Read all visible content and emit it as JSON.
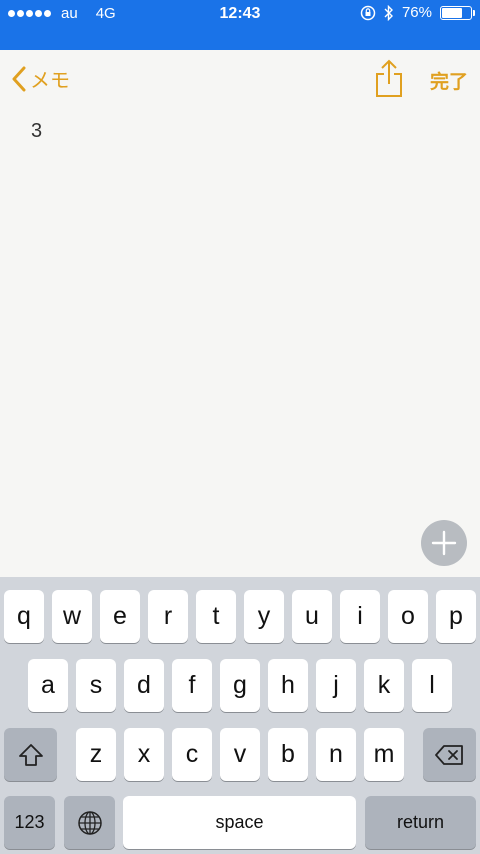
{
  "status_bar": {
    "carrier": "au",
    "network": "4G",
    "time": "12:43",
    "battery": "76%",
    "battery_level": 0.76,
    "background_color": "#1a73e8"
  },
  "nav": {
    "back_label": "メモ",
    "done_label": "完了",
    "accent_color": "#e0a020"
  },
  "note": {
    "content": "3"
  },
  "keyboard": {
    "row1": [
      "q",
      "w",
      "e",
      "r",
      "t",
      "y",
      "u",
      "i",
      "o",
      "p"
    ],
    "row2": [
      "a",
      "s",
      "d",
      "f",
      "g",
      "h",
      "j",
      "k",
      "l"
    ],
    "row3": [
      "z",
      "x",
      "c",
      "v",
      "b",
      "n",
      "m"
    ],
    "numbers_label": "123",
    "space_label": "space",
    "return_label": "return"
  }
}
